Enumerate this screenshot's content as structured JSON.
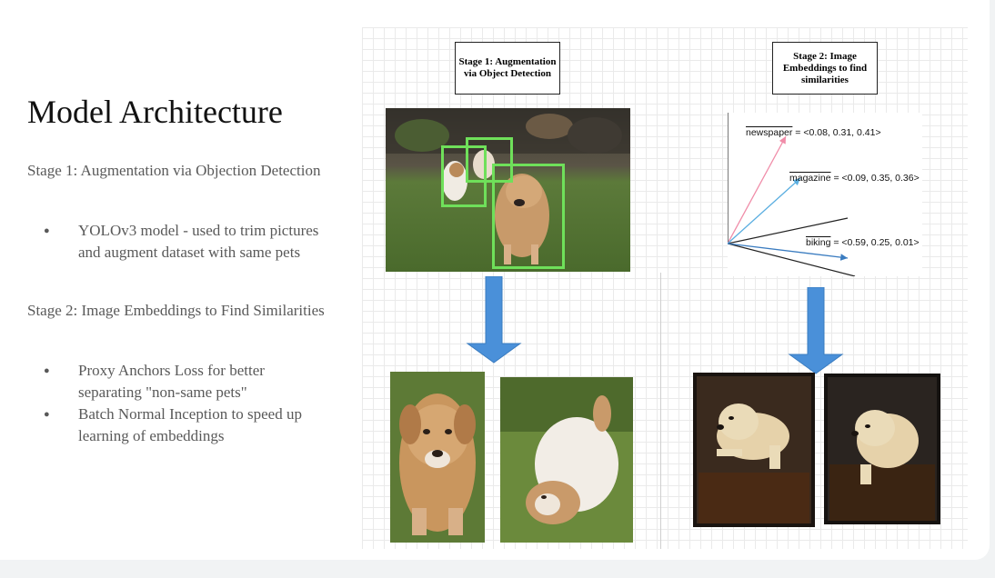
{
  "slide": {
    "title": "Model Architecture",
    "stage1_heading": "Stage 1: Augmentation via Objection Detection",
    "stage1_bullets": [
      "YOLOv3 model - used to trim pictures and augment dataset with same pets"
    ],
    "stage2_heading": "Stage 2: Image Embeddings to Find Similarities",
    "stage2_bullets": [
      "Proxy Anchors Loss for better separating \"non-same pets\"",
      "Batch Normal Inception to speed up learning of embeddings"
    ]
  },
  "diagram": {
    "stage1_box": "Stage 1: Augmentation via Object Detection",
    "stage2_box": "Stage 2: Image Embeddings to find similarities",
    "vectors": [
      {
        "word": "newspaper",
        "value": " = <0.08, 0.31, 0.41>"
      },
      {
        "word": "magazine",
        "value": " = <0.09, 0.35, 0.36>"
      },
      {
        "word": "biking",
        "value": " = <0.59, 0.25, 0.01>"
      }
    ],
    "colors": {
      "arrow_fill": "#4a90d9",
      "arrow_stroke": "#3a7cc0",
      "detection_box": "#6fe05a",
      "pink_vector": "#f08ca8",
      "blue_vector": "#5aaee0"
    },
    "icons": [
      "down-arrow-icon",
      "down-arrow-icon"
    ]
  }
}
